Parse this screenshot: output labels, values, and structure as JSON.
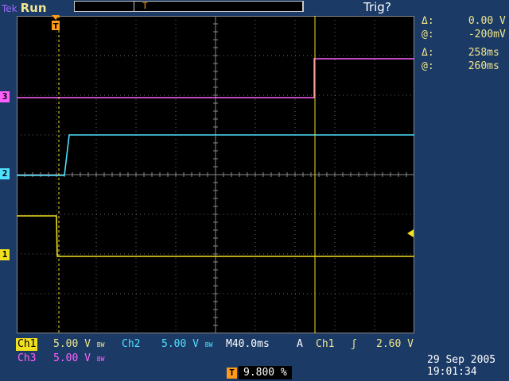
{
  "header": {
    "brand": "Tek",
    "status": "Run",
    "trigger_status": "Trig?",
    "record_marker": "T"
  },
  "cursors": {
    "v_delta_symbol": "Δ:",
    "v_delta": "0.00 V",
    "v_at_symbol": "@:",
    "v_at": "-200mV",
    "t_delta_symbol": "Δ:",
    "t_delta": "258ms",
    "t_at_symbol": "@:",
    "t_at": "260ms"
  },
  "channels": {
    "ch1": {
      "label": "Ch1",
      "scale": "5.00 V",
      "marker": "1",
      "color": "#f0e020"
    },
    "ch2": {
      "label": "Ch2",
      "scale": "5.00 V",
      "marker": "2",
      "color": "#50e0ff"
    },
    "ch3": {
      "label": "Ch3",
      "scale": "5.00 V",
      "marker": "3",
      "color": "#ff60ff"
    }
  },
  "bw_flag": "BW",
  "timebase": "M40.0ms",
  "trigger": {
    "mode": "A",
    "source": "Ch1",
    "slope": "ʃ",
    "level": "2.60 V",
    "position_icon": "T",
    "position": "9.800 %"
  },
  "datetime": {
    "date": "29 Sep  2005",
    "time": "19:01:34"
  },
  "colors": {
    "background": "#1b3a66",
    "screen": "#000000",
    "graticule": "#8a8a8a"
  }
}
